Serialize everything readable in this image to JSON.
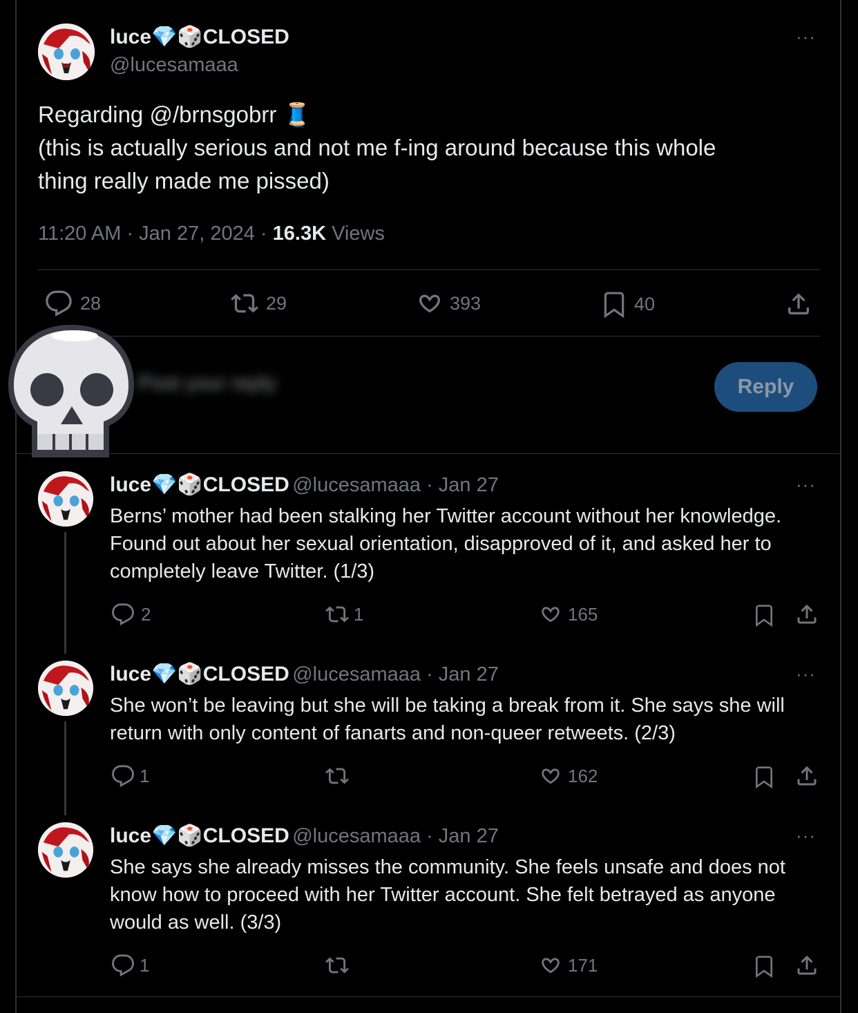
{
  "main_tweet": {
    "display_name": "luce",
    "closed_label": "CLOSED",
    "handle": "@lucesamaaa",
    "text_line1": "Regarding @/brnsgobrr",
    "text_line2": "(this is actually serious and not me f-ing around because this whole",
    "text_line3": "thing really made me pissed)",
    "timestamp": "11:20 AM · Jan 27, 2024 · ",
    "views_count": "16.3K",
    "views_label": " Views",
    "replies": "28",
    "retweets": "29",
    "likes": "393",
    "bookmarks": "40",
    "more": "···"
  },
  "composer": {
    "placeholder": "Post your reply",
    "reply_button": "Reply"
  },
  "replies": [
    {
      "display_name": "luce",
      "closed_label": "CLOSED",
      "handle": "@lucesamaaa",
      "date": " · Jan 27",
      "text": "Berns’ mother had been stalking her Twitter account without her knowledge. Found out about her sexual orientation, disapproved of it, and asked her to completely leave Twitter. (1/3)",
      "replies": "2",
      "retweets": "1",
      "likes": "165",
      "more": "···"
    },
    {
      "display_name": "luce",
      "closed_label": "CLOSED",
      "handle": "@lucesamaaa",
      "date": " · Jan 27",
      "text": "She won’t be leaving but she will be taking a break from it. She says she will return with only content of fanarts and non-queer retweets. (2/3)",
      "replies": "1",
      "retweets": "",
      "likes": "162",
      "more": "···"
    },
    {
      "display_name": "luce",
      "closed_label": "CLOSED",
      "handle": "@lucesamaaa",
      "date": " · Jan 27",
      "text": "She says she already misses the community. She feels unsafe and does not know how to proceed with her Twitter account. She felt betrayed as anyone would as well. (3/3)",
      "replies": "1",
      "retweets": "",
      "likes": "171",
      "more": "···"
    }
  ],
  "icons": {
    "reply": "reply-icon",
    "retweet": "retweet-icon",
    "like": "heart-icon",
    "bookmark": "bookmark-icon",
    "share": "share-icon",
    "overlay": "skull-emoji-icon"
  },
  "colors": {
    "background": "#000000",
    "text": "#e7e9ea",
    "secondary": "#71767b",
    "divider": "#2f3336",
    "reply_button": "#1d4d7c"
  }
}
